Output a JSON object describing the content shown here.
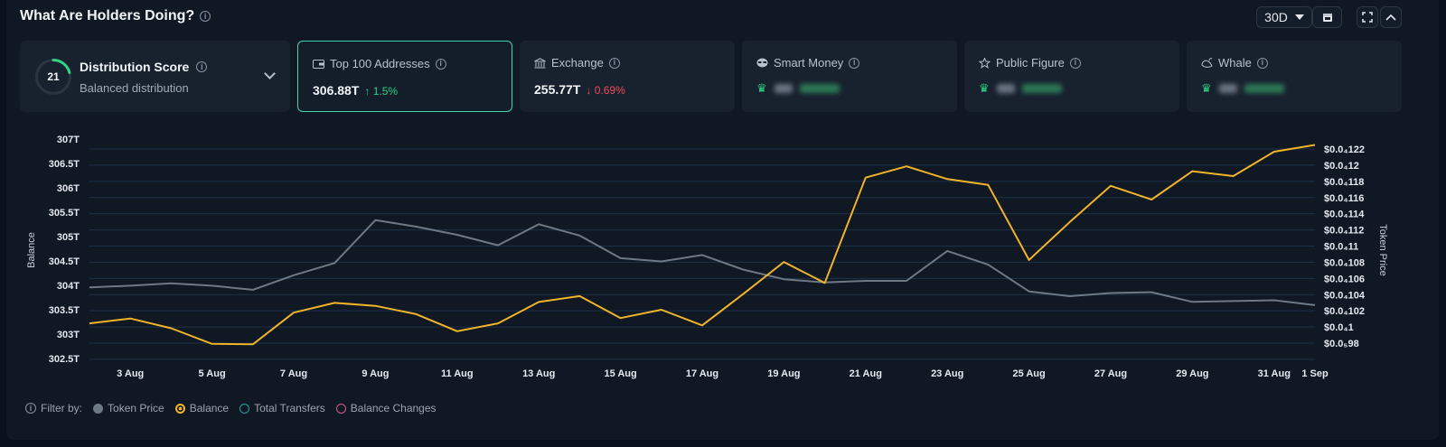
{
  "header": {
    "title": "What Are Holders Doing?",
    "range": "30D"
  },
  "distribution": {
    "score": "21",
    "title": "Distribution Score",
    "subtitle": "Balanced distribution",
    "score_fraction": 0.21
  },
  "cards": [
    {
      "label": "Top 100 Addresses",
      "icon": "wallet-icon",
      "value": "306.88T",
      "change": "1.5%",
      "direction": "up"
    },
    {
      "label": "Exchange",
      "icon": "bank-icon",
      "value": "255.77T",
      "change": "0.69%",
      "direction": "down"
    },
    {
      "label": "Smart Money",
      "icon": "mask-icon"
    },
    {
      "label": "Public Figure",
      "icon": "star-badge-icon"
    },
    {
      "label": "Whale",
      "icon": "whale-icon"
    }
  ],
  "chart_data": {
    "type": "line",
    "ylabel": "Balance",
    "y2label": "Token Price",
    "y_ticks": [
      "307T",
      "306.5T",
      "306T",
      "305.5T",
      "305T",
      "304.5T",
      "304T",
      "303.5T",
      "303T",
      "302.5T"
    ],
    "y2_ticks": [
      "$0.0₄122",
      "$0.0₄12",
      "$0.0₄118",
      "$0.0₄116",
      "$0.0₄114",
      "$0.0₄112",
      "$0.0₄11",
      "$0.0₄108",
      "$0.0₄106",
      "$0.0₄104",
      "$0.0₄102",
      "$0.0₄1",
      "$0.0₅98"
    ],
    "x_ticks": [
      "3 Aug",
      "5 Aug",
      "7 Aug",
      "9 Aug",
      "11 Aug",
      "13 Aug",
      "15 Aug",
      "17 Aug",
      "19 Aug",
      "21 Aug",
      "23 Aug",
      "25 Aug",
      "27 Aug",
      "29 Aug",
      "31 Aug",
      "1 Sep"
    ],
    "ylim": [
      302.5,
      307
    ],
    "series": [
      {
        "name": "Balance",
        "color": "#f0b429",
        "axis": "left",
        "values": [
          303.22,
          303.32,
          303.12,
          302.8,
          302.79,
          303.44,
          303.64,
          303.58,
          303.41,
          303.06,
          303.22,
          303.66,
          303.78,
          303.33,
          303.5,
          303.18,
          303.82,
          304.48,
          304.05,
          306.21,
          306.44,
          306.18,
          306.06,
          304.52,
          305.3,
          306.04,
          305.76,
          306.34,
          306.24,
          306.74,
          306.88
        ]
      },
      {
        "name": "Token Price",
        "color": "#6e7986",
        "axis": "right",
        "values": [
          1.049e-05,
          1.051e-05,
          1.054e-05,
          1.051e-05,
          1.046e-05,
          1.064e-05,
          1.079e-05,
          1.132e-05,
          1.124e-05,
          1.114e-05,
          1.101e-05,
          1.127e-05,
          1.113e-05,
          1.085e-05,
          1.081e-05,
          1.089e-05,
          1.071e-05,
          1.059e-05,
          1.055e-05,
          1.057e-05,
          1.057e-05,
          1.094e-05,
          1.077e-05,
          1.044e-05,
          1.038e-05,
          1.042e-05,
          1.043e-05,
          1.031e-05,
          1.032e-05,
          1.033e-05,
          1.027e-05
        ]
      }
    ],
    "y2lim": [
      1.02e-05,
      1.22e-05
    ],
    "grid": true
  },
  "filter": {
    "label": "Filter by:",
    "items": [
      {
        "label": "Token Price",
        "color": "#6e7986",
        "style": "filled"
      },
      {
        "label": "Balance",
        "color": "#f0b429",
        "style": "selected"
      },
      {
        "label": "Total Transfers",
        "color": "#20a3a0",
        "style": "outline"
      },
      {
        "label": "Balance Changes",
        "color": "#d45c8a",
        "style": "outline"
      }
    ]
  }
}
